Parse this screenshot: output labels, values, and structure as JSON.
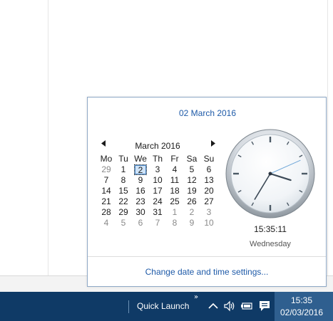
{
  "flyout": {
    "full_date": "02 March 2016",
    "calendar": {
      "prev_icon": "triangle-left-icon",
      "next_icon": "triangle-right-icon",
      "month_label": "March 2016",
      "weekdays": [
        "Mo",
        "Tu",
        "We",
        "Th",
        "Fr",
        "Sa",
        "Su"
      ],
      "days": [
        {
          "label": "29",
          "other": true
        },
        {
          "label": "1",
          "other": false
        },
        {
          "label": "2",
          "other": false,
          "today": true
        },
        {
          "label": "3",
          "other": false
        },
        {
          "label": "4",
          "other": false
        },
        {
          "label": "5",
          "other": false
        },
        {
          "label": "6",
          "other": false
        },
        {
          "label": "7",
          "other": false
        },
        {
          "label": "8",
          "other": false
        },
        {
          "label": "9",
          "other": false
        },
        {
          "label": "10",
          "other": false
        },
        {
          "label": "11",
          "other": false
        },
        {
          "label": "12",
          "other": false
        },
        {
          "label": "13",
          "other": false
        },
        {
          "label": "14",
          "other": false
        },
        {
          "label": "15",
          "other": false
        },
        {
          "label": "16",
          "other": false
        },
        {
          "label": "17",
          "other": false
        },
        {
          "label": "18",
          "other": false
        },
        {
          "label": "19",
          "other": false
        },
        {
          "label": "20",
          "other": false
        },
        {
          "label": "21",
          "other": false
        },
        {
          "label": "22",
          "other": false
        },
        {
          "label": "23",
          "other": false
        },
        {
          "label": "24",
          "other": false
        },
        {
          "label": "25",
          "other": false
        },
        {
          "label": "26",
          "other": false
        },
        {
          "label": "27",
          "other": false
        },
        {
          "label": "28",
          "other": false
        },
        {
          "label": "29",
          "other": false
        },
        {
          "label": "30",
          "other": false
        },
        {
          "label": "31",
          "other": false
        },
        {
          "label": "1",
          "other": true
        },
        {
          "label": "2",
          "other": true
        },
        {
          "label": "3",
          "other": true
        },
        {
          "label": "4",
          "other": true
        },
        {
          "label": "5",
          "other": true
        },
        {
          "label": "6",
          "other": true
        },
        {
          "label": "7",
          "other": true
        },
        {
          "label": "8",
          "other": true
        },
        {
          "label": "9",
          "other": true
        },
        {
          "label": "10",
          "other": true
        }
      ]
    },
    "clock": {
      "time": "15:35:11",
      "weekday": "Wednesday",
      "hours": 15,
      "minutes": 35,
      "seconds": 11
    },
    "settings_link": "Change date and time settings..."
  },
  "taskbar": {
    "quick_launch": "Quick Launch",
    "chevron": "»",
    "tray_icons": [
      "chevron-up-icon",
      "volume-icon",
      "network-icon",
      "action-center-icon"
    ],
    "time": "15:35",
    "date": "02/03/2016"
  },
  "colors": {
    "taskbar": "#0f3a66",
    "taskbar_clock": "#2f5f8f",
    "link": "#1e5aa8",
    "flyout_border": "#8fa9c7"
  }
}
